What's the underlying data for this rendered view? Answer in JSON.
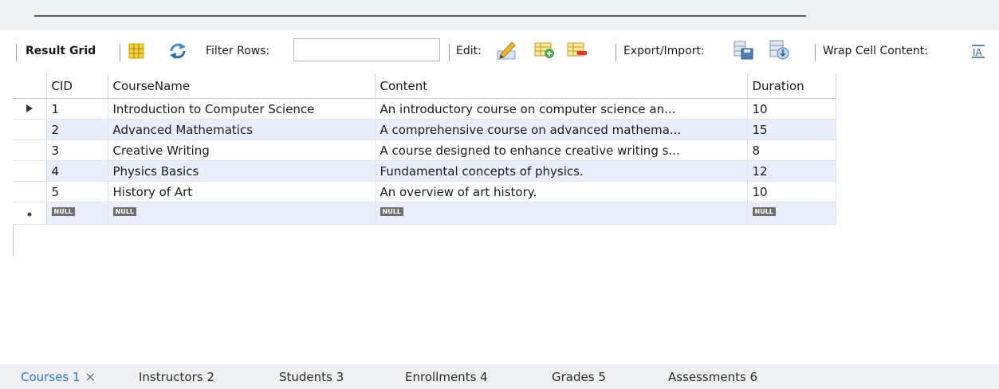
{
  "toolbar": {
    "result_grid_label": "Result Grid",
    "filter_rows_label": "Filter Rows:",
    "filter_rows_value": "",
    "edit_label": "Edit:",
    "export_import_label": "Export/Import:",
    "wrap_cell_label": "Wrap Cell Content:"
  },
  "grid": {
    "columns": [
      "CID",
      "CourseName",
      "Content",
      "Duration"
    ],
    "rows": [
      {
        "cid": "1",
        "name": "Introduction to Computer Science",
        "content": "An introductory course on computer science an...",
        "duration": "10"
      },
      {
        "cid": "2",
        "name": "Advanced Mathematics",
        "content": "A comprehensive course on advanced mathema...",
        "duration": "15"
      },
      {
        "cid": "3",
        "name": "Creative Writing",
        "content": "A course designed to enhance creative writing s...",
        "duration": "8"
      },
      {
        "cid": "4",
        "name": "Physics Basics",
        "content": "Fundamental concepts of physics.",
        "duration": "12"
      },
      {
        "cid": "5",
        "name": "History of Art",
        "content": "An overview of art history.",
        "duration": "10"
      }
    ],
    "null_label": "NULL"
  },
  "tabs": [
    {
      "label": "Courses 1",
      "active": true
    },
    {
      "label": "Instructors 2"
    },
    {
      "label": "Students 3"
    },
    {
      "label": "Enrollments 4"
    },
    {
      "label": "Grades 5"
    },
    {
      "label": "Assessments 6"
    }
  ],
  "tab_close_glyph": "×",
  "colors": {
    "active_tab": "#2f78c4",
    "alt_row": "#e9effa",
    "null_badge": "#6f6f6f"
  }
}
